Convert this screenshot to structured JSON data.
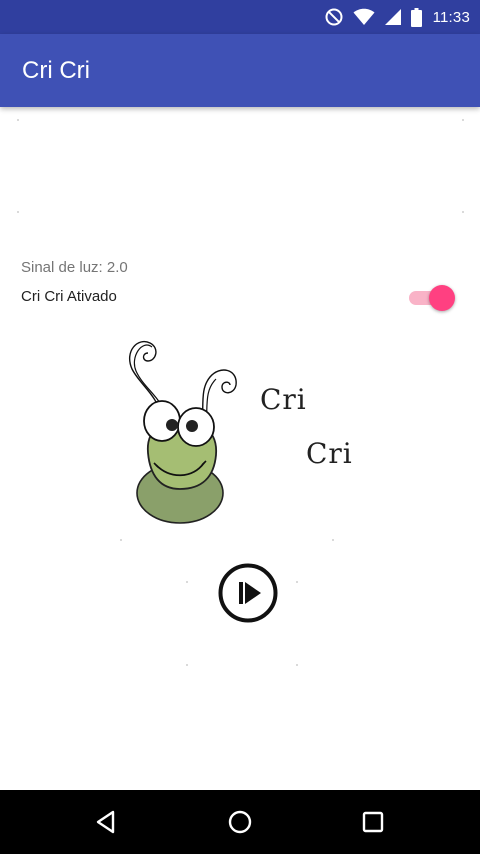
{
  "status_bar": {
    "time": "11:33",
    "icons": [
      "do-not-disturb-icon",
      "wifi-icon",
      "cell-signal-icon",
      "battery-icon"
    ]
  },
  "app_bar": {
    "title": "Cri Cri"
  },
  "main": {
    "light_signal_text": "Sinal de luz: 2.0",
    "switch_label": "Cri Cri Ativado",
    "switch_on": true,
    "image": {
      "logo_text_1": "Cri",
      "logo_text_2": "Cri"
    },
    "play_button_icon": "play-icon"
  },
  "nav_bar": {
    "buttons": [
      "back-icon",
      "home-icon",
      "recents-icon"
    ]
  },
  "colors": {
    "status_bar": "#303f9f",
    "app_bar": "#3f51b5",
    "accent": "#ff4081",
    "switch_track": "#f9b3c7",
    "nav_bar": "#000000"
  }
}
